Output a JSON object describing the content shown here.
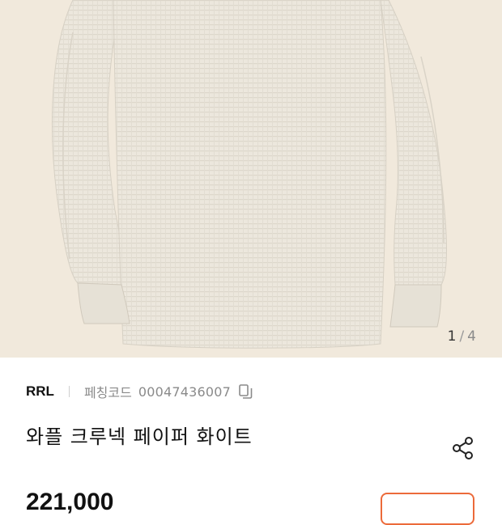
{
  "gallery": {
    "current": "1",
    "separator": "/",
    "total": "4",
    "image_alt": "sweater-product-photo"
  },
  "product": {
    "brand": "RRL",
    "code_label": "페칭코드",
    "code_value": "00047436007",
    "title": "와플 크루넥 페이퍼 화이트",
    "price": "221,000"
  },
  "icons": {
    "copy": "copy-icon",
    "share": "share-icon"
  },
  "colors": {
    "background": "#f1e9dc",
    "sweater": "#ebe6dc",
    "accent": "#ec6a3a"
  }
}
